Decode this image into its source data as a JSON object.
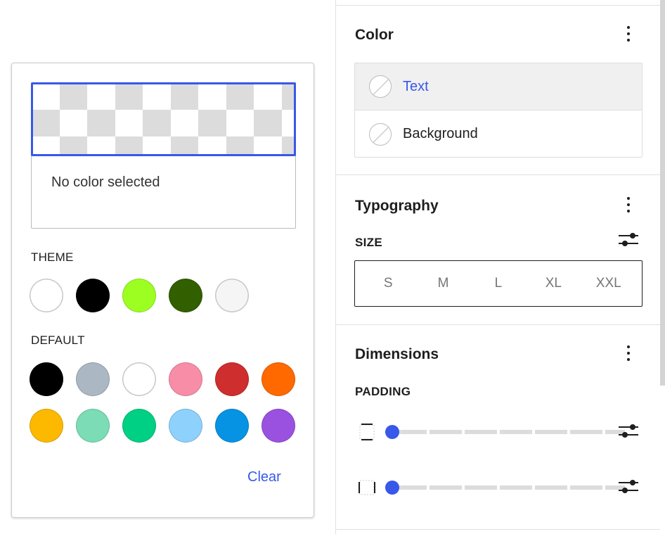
{
  "picker": {
    "no_color_text": "No color selected",
    "theme_label": "THEME",
    "default_label": "DEFAULT",
    "clear_label": "Clear",
    "theme_colors": [
      "#ffffff",
      "#000000",
      "#9cff21",
      "#325f00",
      "#f5f5f5"
    ],
    "default_colors": [
      "#000000",
      "#abb8c3",
      "#ffffff",
      "#f78da7",
      "#cf2e2e",
      "#ff6900",
      "#fcb900",
      "#7bdcb5",
      "#00d084",
      "#8ed1fc",
      "#0693e3",
      "#9b51e0"
    ]
  },
  "sidebar": {
    "color_panel": {
      "title": "Color",
      "items": [
        {
          "label": "Text"
        },
        {
          "label": "Background"
        }
      ]
    },
    "typography_panel": {
      "title": "Typography",
      "size_label": "SIZE",
      "sizes": [
        "S",
        "M",
        "L",
        "XL",
        "XXL"
      ]
    },
    "dimensions_panel": {
      "title": "Dimensions",
      "padding_label": "PADDING"
    }
  },
  "colors": {
    "accent": "#3858e9",
    "checker": "#dcdcdc"
  }
}
